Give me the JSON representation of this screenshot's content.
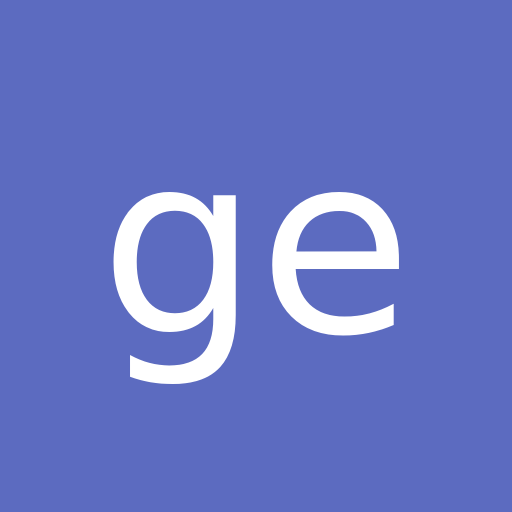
{
  "avatar": {
    "initials": "ge",
    "background_color": "#5c6bc0",
    "text_color": "#ffffff"
  }
}
